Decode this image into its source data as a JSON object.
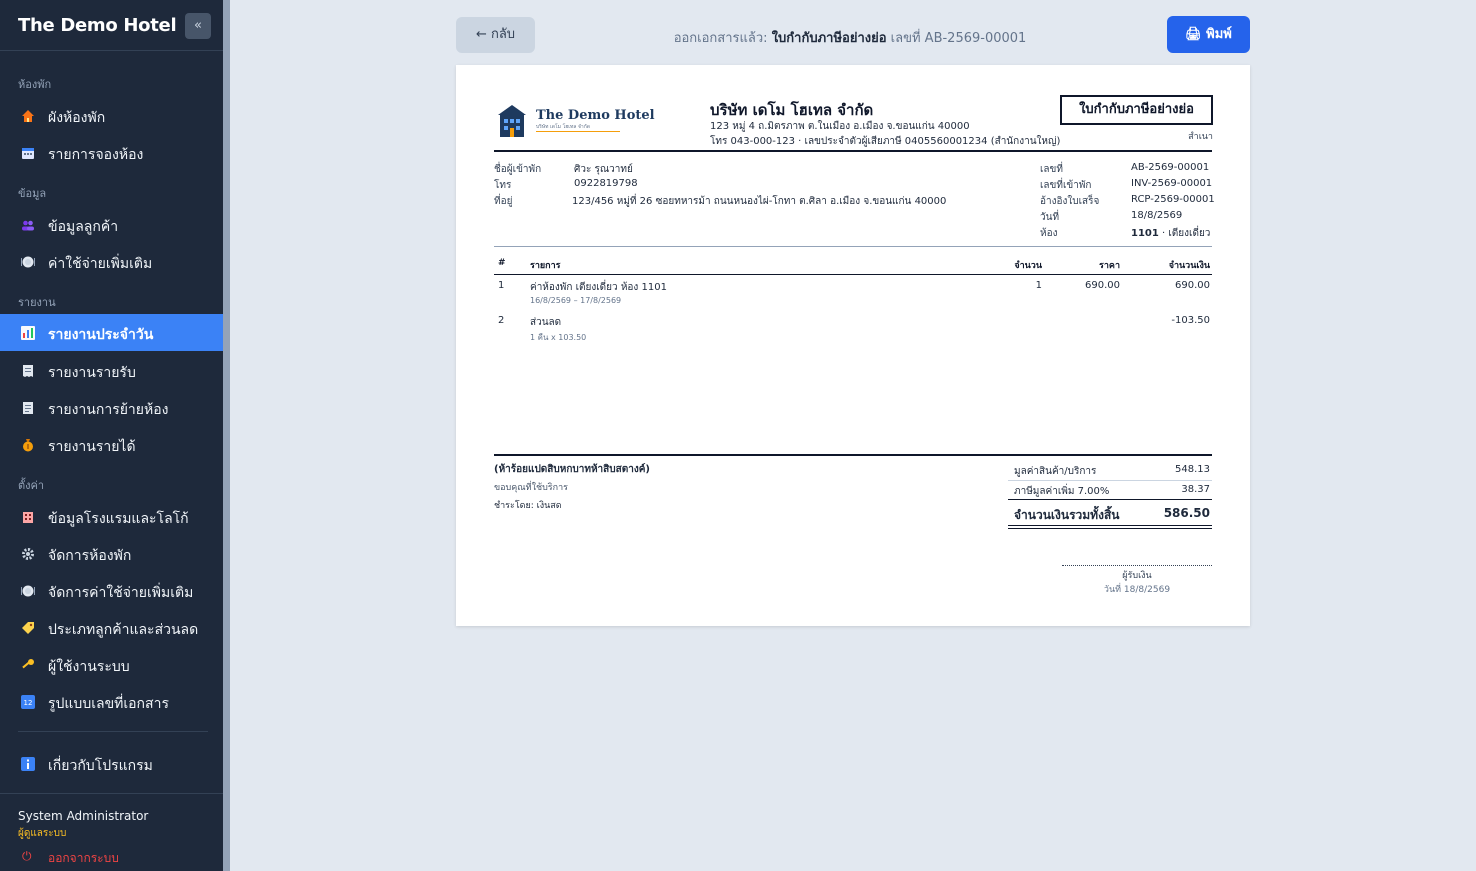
{
  "app": {
    "brand": "The Demo Hotel",
    "collapse": "«"
  },
  "sidebar": {
    "sections": [
      {
        "title": "ห้องพัก",
        "items": [
          {
            "label": "ผังห้องพัก",
            "icon": "house-icon",
            "color": "#f97316"
          },
          {
            "label": "รายการจองห้อง",
            "icon": "calendar-icon",
            "color": "#60a5fa"
          }
        ]
      },
      {
        "title": "ข้อมูล",
        "items": [
          {
            "label": "ข้อมูลลูกค้า",
            "icon": "users-icon",
            "color": "#8b5cf6"
          },
          {
            "label": "ค่าใช้จ่ายเพิ่มเติม",
            "icon": "dish-icon",
            "color": "#e2e8f0"
          }
        ]
      },
      {
        "title": "รายงาน",
        "items": [
          {
            "label": "รายงานประจำวัน",
            "icon": "chart-icon",
            "color": "#fbbf24"
          },
          {
            "label": "รายงานรายรับ",
            "icon": "receipt-icon",
            "color": "#e2e8f0"
          },
          {
            "label": "รายงานการย้ายห้อง",
            "icon": "document-icon",
            "color": "#e2e8f0"
          },
          {
            "label": "รายงานรายได้",
            "icon": "money-bag-icon",
            "color": "#f59e0b"
          }
        ]
      },
      {
        "title": "ตั้งค่า",
        "items": [
          {
            "label": "ข้อมูลโรงแรมและโลโก้",
            "icon": "hotel-icon",
            "color": "#f87171"
          },
          {
            "label": "จัดการห้องพัก",
            "icon": "gear-icon",
            "color": "#cbd5e1"
          },
          {
            "label": "จัดการค่าใช้จ่ายเพิ่มเติม",
            "icon": "dish-icon",
            "color": "#e2e8f0"
          },
          {
            "label": "ประเภทลูกค้าและส่วนลด",
            "icon": "tag-icon",
            "color": "#fcd34d"
          },
          {
            "label": "ผู้ใช้งานระบบ",
            "icon": "key-icon",
            "color": "#fbbf24"
          },
          {
            "label": "รูปแบบเลขที่เอกสาร",
            "icon": "numbers-icon",
            "color": "#60a5fa"
          }
        ]
      }
    ],
    "about": {
      "label": "เกี่ยวกับโปรแกรม",
      "icon": "info-icon",
      "color": "#3b82f6"
    },
    "active": "รายงานประจำวัน",
    "user": {
      "name": "System Administrator",
      "role": "ผู้ดูแลระบบ",
      "logout": "ออกจากระบบ",
      "logout_icon": "⏻"
    }
  },
  "topbar": {
    "back": "← กลับ",
    "status_prefix": "ออกเอกสารแล้ว:",
    "status_doc": "ใบกำกับภาษีอย่างย่อ",
    "status_suffix": "เลขที่ AB-2569-00001",
    "print": "🖨 พิมพ์"
  },
  "document": {
    "logo_name": "The Demo Hotel",
    "logo_sub": "บริษัท เดโม โฮเทล จำกัด",
    "company": "บริษัท เดโม โฮเทล จำกัด",
    "address": "123 หมู่ 4 ถ.มิตรภาพ ต.ในเมือง อ.เมือง จ.ขอนแก่น 40000",
    "contact": "โทร 043-000-123 · เลขประจำตัวผู้เสียภาษี 0405560001234 (สำนักงานใหญ่)",
    "title": "ใบกำกับภาษีอย่างย่อ",
    "copy": "สำเนา",
    "customer": [
      {
        "label": "ชื่อผู้เข้าพัก",
        "value": "ศิวะ รุณวาทย์"
      },
      {
        "label": "โทร",
        "value": "0922819798"
      },
      {
        "label": "ที่อยู่",
        "value": "123/456 หมู่ที่ 26 ซอยทหารม้า ถนนหนองไผ่-โกทา ต.ศิลา อ.เมือง จ.ขอนแก่น 40000"
      }
    ],
    "meta": [
      {
        "label": "เลขที่",
        "value": "AB-2569-00001"
      },
      {
        "label": "เลขที่เข้าพัก",
        "value": "INV-2569-00001"
      },
      {
        "label": "อ้างอิงใบเสร็จ",
        "value": "RCP-2569-00001"
      },
      {
        "label": "วันที่",
        "value": "18/8/2569"
      },
      {
        "label": "ห้อง",
        "value_bold": "1101",
        "value": " · เตียงเดี่ยว"
      }
    ],
    "table": {
      "headers": {
        "no": "#",
        "desc": "รายการ",
        "qty": "จำนวน",
        "price": "ราคา",
        "amount": "จำนวนเงิน"
      },
      "rows": [
        {
          "no": "1",
          "desc": "ค่าห้องพัก เตียงเดี่ยว ห้อง 1101",
          "sub": "16/8/2569 – 17/8/2569",
          "qty": "1",
          "price": "690.00",
          "amount": "690.00"
        },
        {
          "no": "2",
          "desc": "ส่วนลด",
          "sub": "1 คืน x 103.50",
          "qty": "",
          "price": "",
          "amount": "-103.50"
        }
      ]
    },
    "amount_words": "(ห้าร้อยแปดสิบหกบาทห้าสิบสตางค์)",
    "thanks": "ขอบคุณที่ใช้บริการ",
    "payment": "ชำระโดย: เงินสด",
    "totals": {
      "subtotal_label": "มูลค่าสินค้า/บริการ",
      "subtotal": "548.13",
      "vat_label": "ภาษีมูลค่าเพิ่ม 7.00%",
      "vat": "38.37",
      "grand_label": "จำนวนเงินรวมทั้งสิ้น",
      "grand": "586.50"
    },
    "signer": "ผู้รับเงิน",
    "sign_date": "วันที่ 18/8/2569"
  }
}
